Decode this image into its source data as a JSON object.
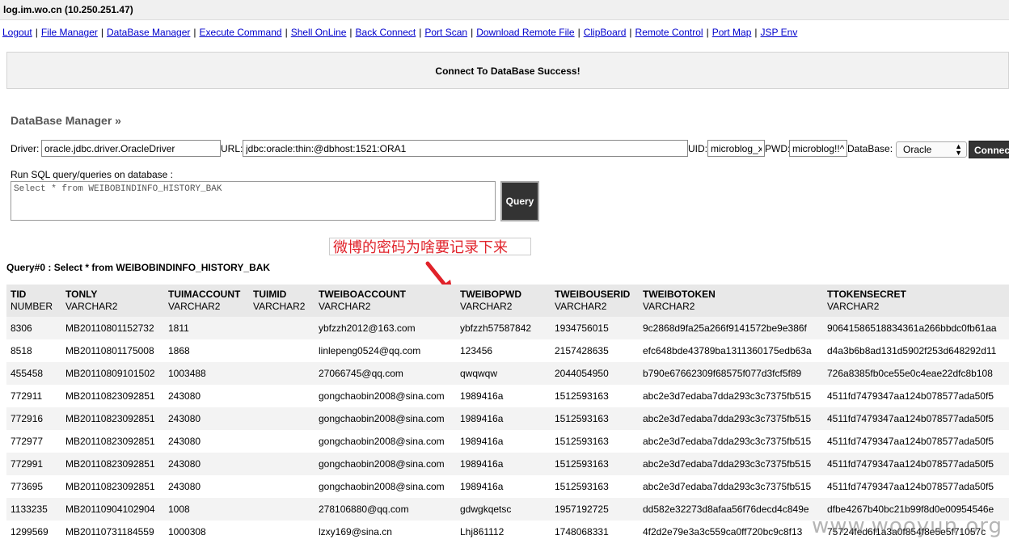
{
  "header": {
    "host": "log.im.wo.cn (10.250.251.47)"
  },
  "nav": [
    "Logout",
    "File Manager",
    "DataBase Manager",
    "Execute Command",
    "Shell OnLine",
    "Back Connect",
    "Port Scan",
    "Download Remote File",
    "ClipBoard",
    "Remote Control",
    "Port Map",
    "JSP Env"
  ],
  "message": "Connect To DataBase Success!",
  "db": {
    "title": "DataBase Manager »",
    "driver_label": "Driver:",
    "driver_value": "oracle.jdbc.driver.OracleDriver",
    "url_label": "URL:",
    "url_value": "jdbc:oracle:thin:@dbhost:1521:ORA1",
    "uid_label": "UID:",
    "uid_value": "microblog_x",
    "pwd_label": "PWD:",
    "pwd_value": "microblog!!^",
    "database_label": "DataBase:",
    "database_selected": "Oracle",
    "connect_label": "Connect"
  },
  "query": {
    "label": "Run SQL query/queries on database :",
    "sql": "Select * from WEIBOBINDINFO_HISTORY_BAK",
    "button": "Query"
  },
  "annotation": "微博的密码为啥要记录下来",
  "result": {
    "title": "Query#0 : Select * from WEIBOBINDINFO_HISTORY_BAK",
    "columns": [
      {
        "name": "TID",
        "type": "NUMBER"
      },
      {
        "name": "TONLY",
        "type": "VARCHAR2"
      },
      {
        "name": "TUIMACCOUNT",
        "type": "VARCHAR2"
      },
      {
        "name": "TUIMID",
        "type": "VARCHAR2"
      },
      {
        "name": "TWEIBOACCOUNT",
        "type": "VARCHAR2"
      },
      {
        "name": "TWEIBOPWD",
        "type": "VARCHAR2"
      },
      {
        "name": "TWEIBOUSERID",
        "type": "VARCHAR2"
      },
      {
        "name": "TWEIBOTOKEN",
        "type": "VARCHAR2"
      },
      {
        "name": "TTOKENSECRET",
        "type": "VARCHAR2"
      }
    ],
    "rows": [
      [
        "8306",
        "MB20110801152732",
        "1811",
        "",
        "ybfzzh2012@163.com",
        "ybfzzh57587842",
        "1934756015",
        "9c2868d9fa25a266f9141572be9e386f",
        "90641586518834361a266bbdc0fb61aa"
      ],
      [
        "8518",
        "MB20110801175008",
        "1868",
        "",
        "linlepeng0524@qq.com",
        "123456",
        "2157428635",
        "efc648bde43789ba1311360175edb63a",
        "d4a3b6b8ad131d5902f253d648292d11"
      ],
      [
        "455458",
        "MB20110809101502",
        "1003488",
        "",
        "27066745@qq.com",
        "qwqwqw",
        "2044054950",
        "b790e67662309f68575f077d3fcf5f89",
        "726a8385fb0ce55e0c4eae22dfc8b108"
      ],
      [
        "772911",
        "MB20110823092851",
        "243080",
        "",
        "gongchaobin2008@sina.com",
        "1989416a",
        "1512593163",
        "abc2e3d7edaba7dda293c3c7375fb515",
        "4511fd7479347aa124b078577ada50f5"
      ],
      [
        "772916",
        "MB20110823092851",
        "243080",
        "",
        "gongchaobin2008@sina.com",
        "1989416a",
        "1512593163",
        "abc2e3d7edaba7dda293c3c7375fb515",
        "4511fd7479347aa124b078577ada50f5"
      ],
      [
        "772977",
        "MB20110823092851",
        "243080",
        "",
        "gongchaobin2008@sina.com",
        "1989416a",
        "1512593163",
        "abc2e3d7edaba7dda293c3c7375fb515",
        "4511fd7479347aa124b078577ada50f5"
      ],
      [
        "772991",
        "MB20110823092851",
        "243080",
        "",
        "gongchaobin2008@sina.com",
        "1989416a",
        "1512593163",
        "abc2e3d7edaba7dda293c3c7375fb515",
        "4511fd7479347aa124b078577ada50f5"
      ],
      [
        "773695",
        "MB20110823092851",
        "243080",
        "",
        "gongchaobin2008@sina.com",
        "1989416a",
        "1512593163",
        "abc2e3d7edaba7dda293c3c7375fb515",
        "4511fd7479347aa124b078577ada50f5"
      ],
      [
        "1133235",
        "MB20110904102904",
        "1008",
        "",
        "278106880@qq.com",
        "gdwgkqetsc",
        "1957192725",
        "dd582e32273d8afaa56f76decd4c849e",
        "dfbe4267b40bc21b99f8d0e00954546e"
      ],
      [
        "1299569",
        "MB20110731184559",
        "1000308",
        "",
        "lzxy169@sina.cn",
        "Lhj861112",
        "1748068331",
        "4f2d2e79e3a3c559ca0ff720bc9c8f13",
        "75724fed6f1a3a0f854f8e5e5f71057c"
      ]
    ]
  },
  "watermark": "www.wooyun.org"
}
